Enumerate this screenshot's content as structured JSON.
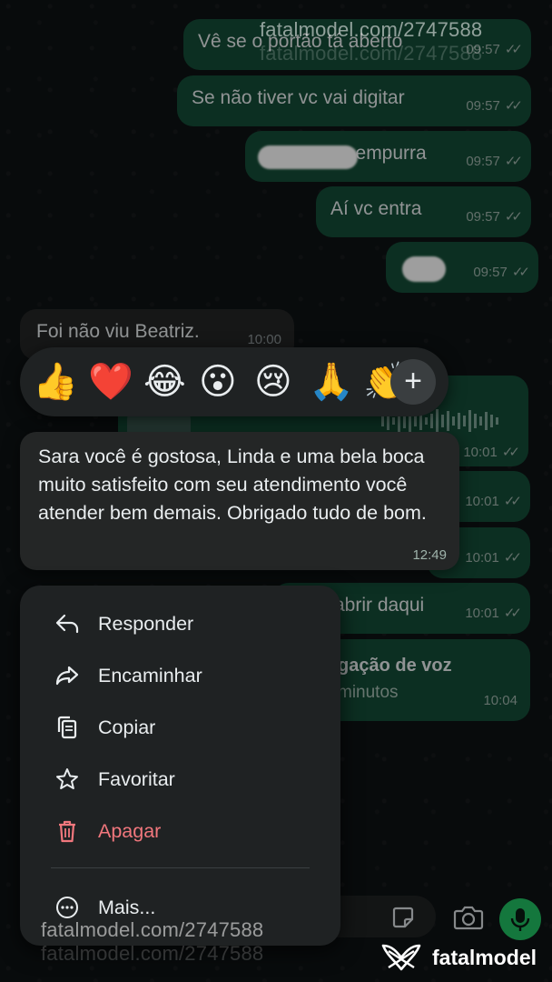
{
  "watermark": {
    "text": "fatalmodel.com/2747588",
    "brand": "fatalmodel"
  },
  "messages": [
    {
      "text": "Vê se o portão tá aberto",
      "time": "09:57",
      "dir": "out"
    },
    {
      "text": "Se não tiver vc vai digitar",
      "time": "09:57",
      "dir": "out"
    },
    {
      "text": "e empurra",
      "time": "09:57",
      "dir": "out"
    },
    {
      "text": "Aí vc entra",
      "time": "09:57",
      "dir": "out"
    },
    {
      "text": "",
      "time": "09:57",
      "dir": "out"
    },
    {
      "text": "Foi não viu Beatriz.",
      "time": "10:00",
      "dir": "in"
    },
    {
      "text": "",
      "time": "10:01",
      "dir": "out"
    },
    {
      "text": "",
      "time": "10:01",
      "dir": "out"
    },
    {
      "text": "",
      "time": "10:01",
      "dir": "out"
    },
    {
      "text": "abrir daqui",
      "time": "10:01",
      "dir": "out"
    },
    {
      "text": "gação de voz",
      "subtext": "minutos",
      "time": "10:04",
      "dir": "out"
    }
  ],
  "reactions": {
    "emojis": [
      "👍",
      "❤️",
      "😂",
      "😮",
      "😢",
      "🙏",
      "👏"
    ],
    "more": "+"
  },
  "focused_message": {
    "text": "Sara você é gostosa, Linda e uma bela boca muito satisfeito com seu atendimento você atender bem demais. Obrigado tudo de bom.",
    "time": "12:49"
  },
  "context_menu": {
    "items": [
      {
        "label": "Responder",
        "icon": "reply-icon"
      },
      {
        "label": "Encaminhar",
        "icon": "forward-icon"
      },
      {
        "label": "Copiar",
        "icon": "copy-icon"
      },
      {
        "label": "Favoritar",
        "icon": "star-icon"
      },
      {
        "label": "Apagar",
        "icon": "trash-icon",
        "danger": true
      },
      {
        "label": "Mais...",
        "icon": "more-icon"
      }
    ]
  },
  "colors": {
    "outgoing": "#144d37",
    "incoming": "#242626",
    "danger": "#f1777d",
    "mic": "#21c063"
  }
}
